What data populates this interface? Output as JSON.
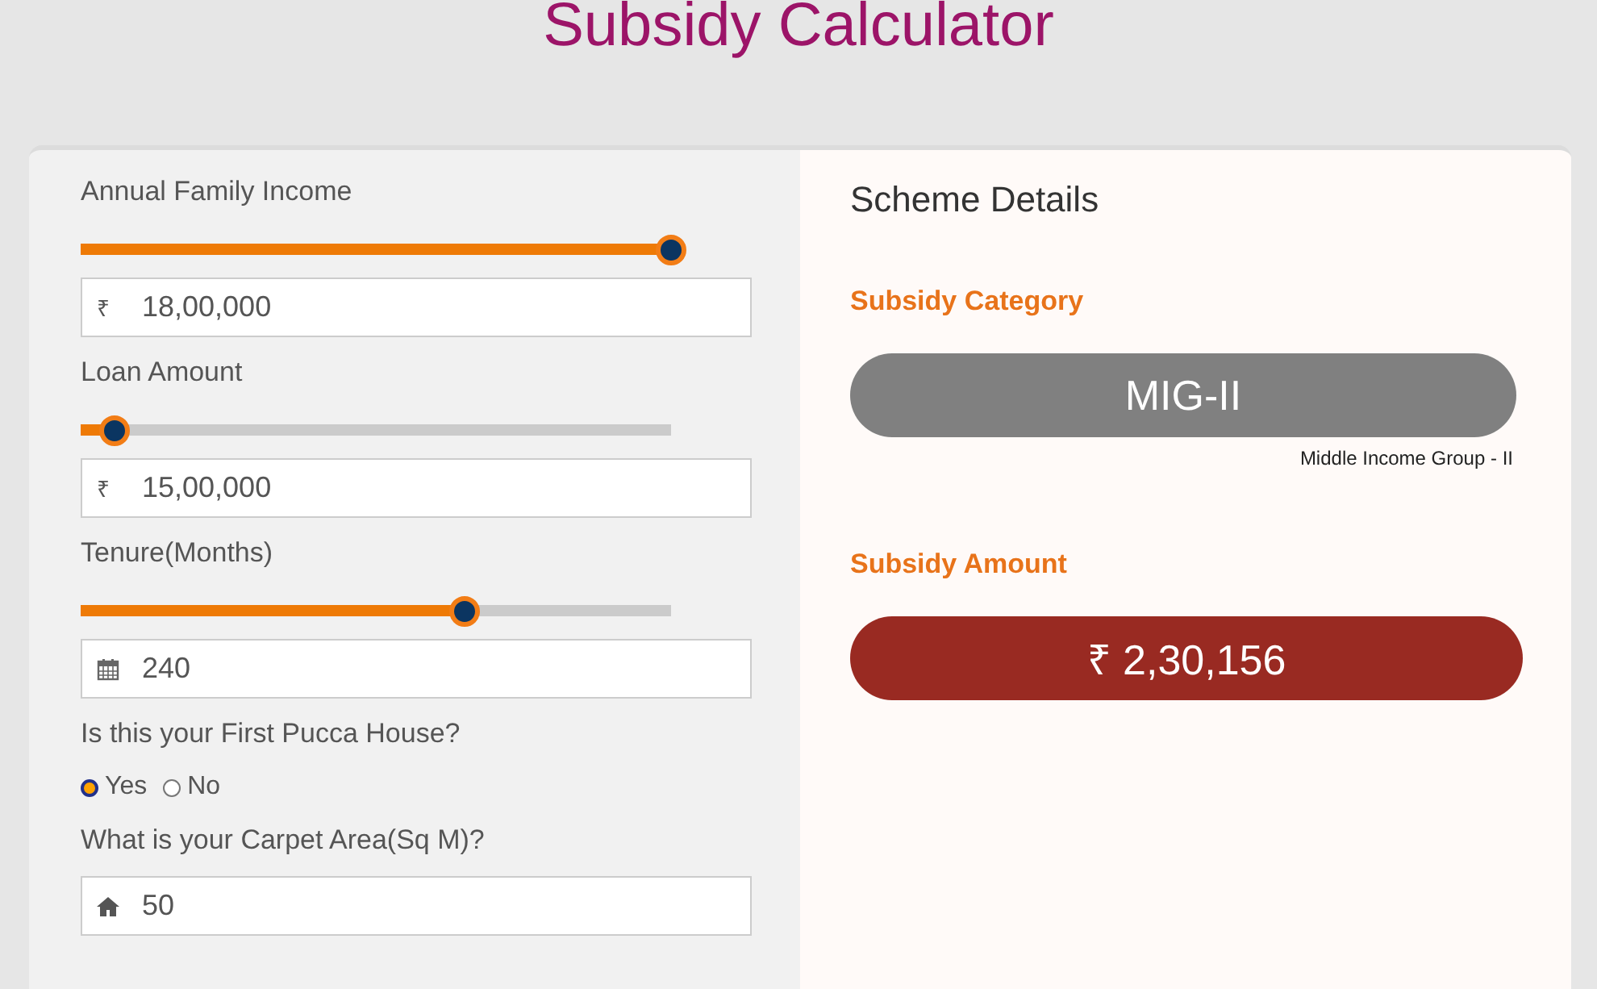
{
  "title": "Subsidy Calculator",
  "inputs": [
    {
      "heading": "Annual Family Income",
      "level": 1,
      "kind": "currency",
      "prefix": "₹",
      "value": "18,00,000"
    },
    {
      "heading": "Loan Amount",
      "level": 0.057,
      "kind": "currency",
      "prefix": "₹",
      "value": "15,00,000"
    },
    {
      "heading": "Tenure(Months)",
      "level": 0.65,
      "kind": "calendar",
      "value": "240"
    }
  ],
  "first_house": {
    "question": "Is this your First Pucca House?",
    "options": [
      {
        "label": "Yes",
        "selected": true
      },
      {
        "label": "No",
        "selected": false
      }
    ]
  },
  "carpet_area": {
    "question": "What is your Carpet Area(Sq M)?",
    "kind": "home",
    "value": "50"
  },
  "scheme": {
    "heading": "Scheme Details",
    "category_label": "Subsidy Category",
    "category": "MIG-II",
    "category_note": "Middle Income Group - II",
    "amount_label": "Subsidy Amount",
    "amount": "₹ 2,30,156"
  }
}
